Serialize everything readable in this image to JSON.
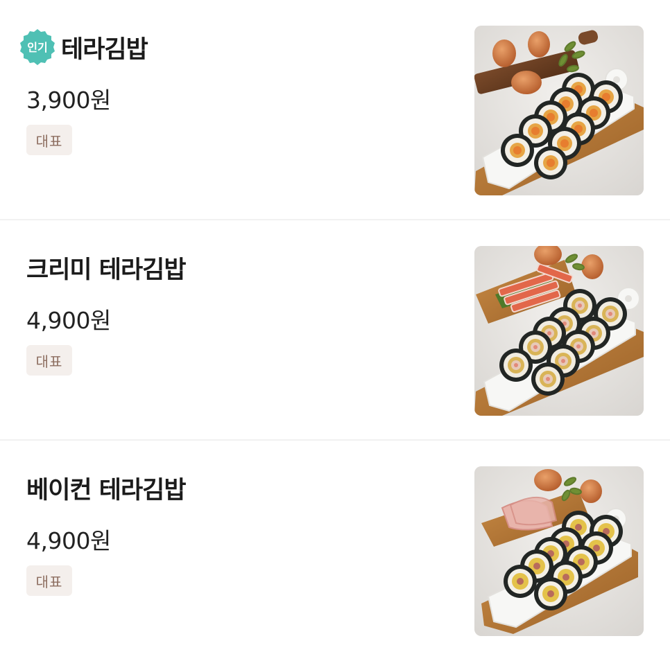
{
  "menu": {
    "items": [
      {
        "popular_badge": "인기",
        "name": "테라김밥",
        "price": "3,900원",
        "tag": "대표",
        "image_icon": "egg-kimbap-plate-photo"
      },
      {
        "name": "크리미 테라김밥",
        "price": "4,900원",
        "tag": "대표",
        "image_icon": "crab-kimbap-plate-photo"
      },
      {
        "name": "베이컨 테라김밥",
        "price": "4,900원",
        "tag": "대표",
        "image_icon": "bacon-kimbap-plate-photo"
      }
    ]
  },
  "colors": {
    "badge_teal": "#4fc0b4",
    "tag_bg": "#f4efec",
    "tag_text": "#8c6d5f",
    "divider": "#f1f1f1",
    "text_primary": "#1b1b1b"
  }
}
